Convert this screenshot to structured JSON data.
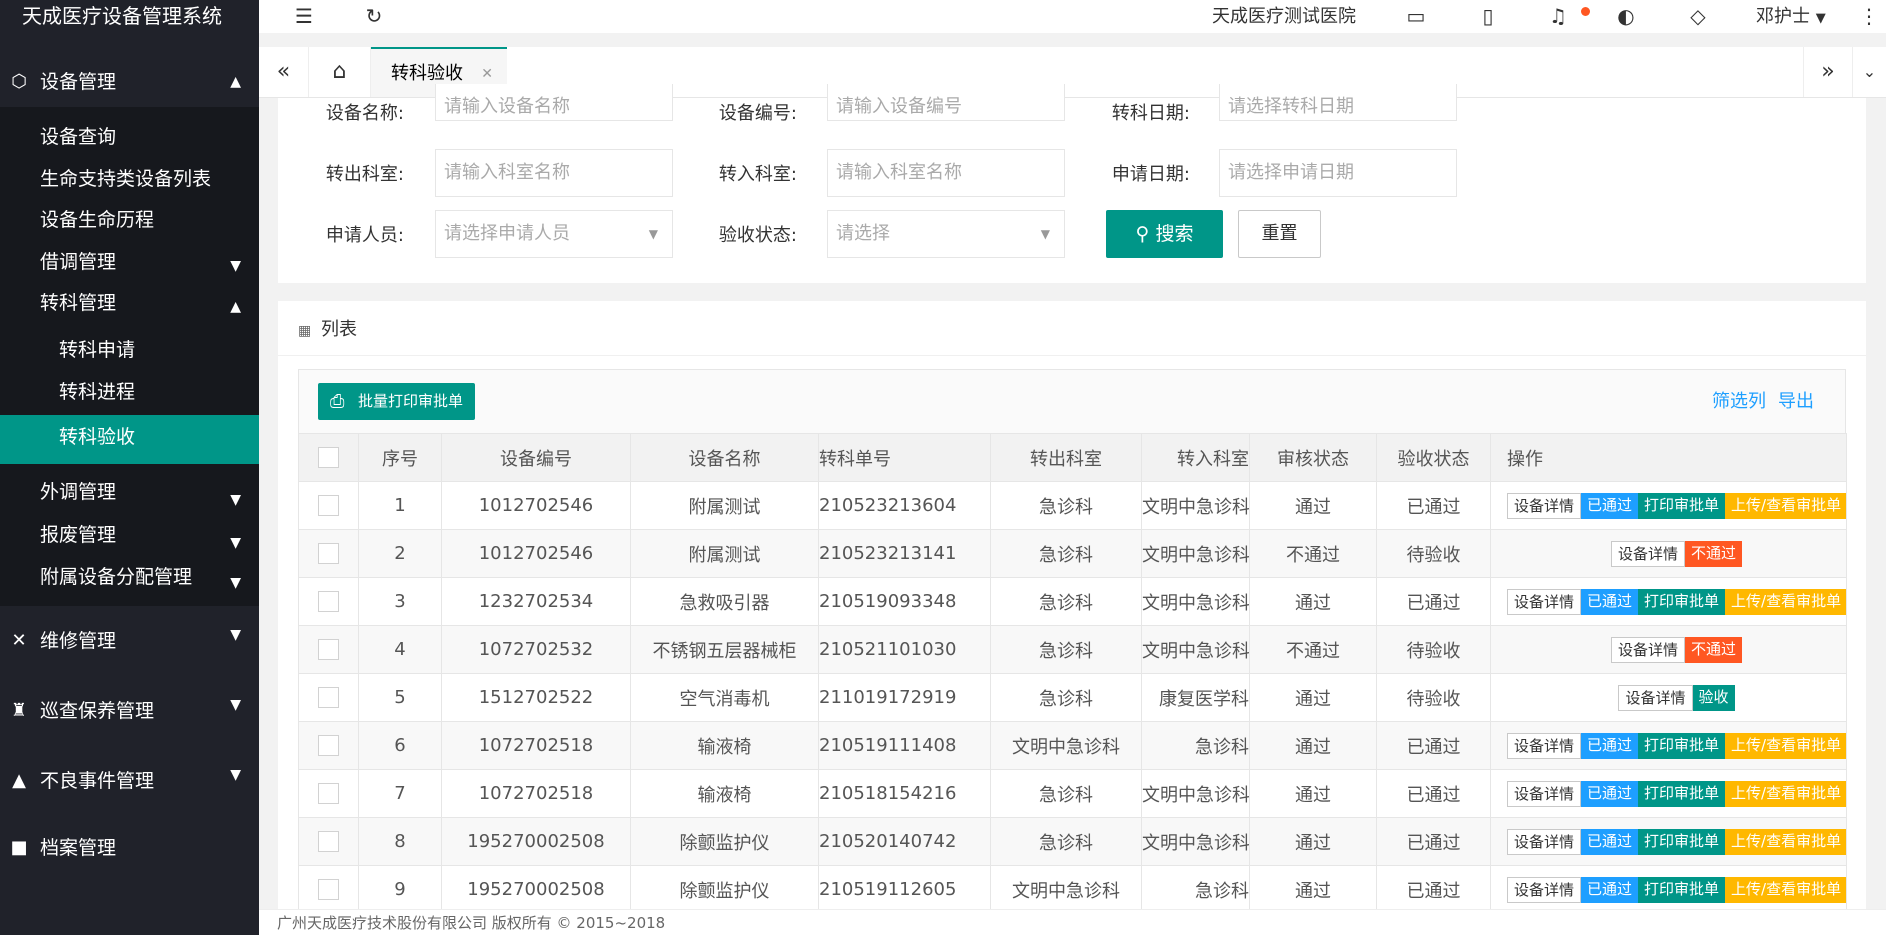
{
  "app": {
    "title": "天成医疗设备管理系统"
  },
  "sidebar": {
    "group_equipment": "设备管理",
    "items": {
      "query": "设备查询",
      "life_support": "生命支持类设备列表",
      "lifecycle": "设备生命历程",
      "loan": "借调管理",
      "transfer": "转科管理",
      "transfer_apply": "转科申请",
      "transfer_progress": "转科进程",
      "transfer_accept": "转科验收",
      "external_loan": "外调管理",
      "scrap": "报废管理",
      "accessory": "附属设备分配管理"
    },
    "group_repair": "维修管理",
    "group_inspection": "巡查保养管理",
    "group_adverse": "不良事件管理",
    "group_more": "档案管理"
  },
  "header": {
    "hospital": "天成医疗测试医院",
    "user": "邓护士"
  },
  "tabs": {
    "active": "转科验收"
  },
  "search": {
    "device_name": {
      "label": "设备名称:",
      "placeholder": "请输入设备名称"
    },
    "device_no": {
      "label": "设备编号:",
      "placeholder": "请输入设备编号"
    },
    "transfer_date": {
      "label": "转科日期:",
      "placeholder": "请选择转科日期"
    },
    "out_dept": {
      "label": "转出科室:",
      "placeholder": "请输入科室名称"
    },
    "in_dept": {
      "label": "转入科室:",
      "placeholder": "请输入科室名称"
    },
    "apply_date": {
      "label": "申请日期:",
      "placeholder": "请选择申请日期"
    },
    "applicant": {
      "label": "申请人员:",
      "placeholder": "请选择申请人员"
    },
    "accept_status": {
      "label": "验收状态:",
      "placeholder": "请选择"
    },
    "search_btn": "搜索",
    "reset_btn": "重置"
  },
  "list": {
    "title": "列表",
    "batch_print": "批量打印审批单",
    "filter_cols": "筛选列",
    "export": "导出",
    "columns": [
      "序号",
      "设备编号",
      "设备名称",
      "转科单号",
      "转出科室",
      "转入科室",
      "审核状态",
      "验收状态",
      "操作"
    ],
    "rows": [
      {
        "idx": "1",
        "device_no": "1012702546",
        "name": "附属测试",
        "order": "210523213604",
        "out": "急诊科",
        "in": "文明中急诊科",
        "audit": "通过",
        "audit_ok": true,
        "accept": "已通过",
        "accept_done": true,
        "ops": [
          "设备详情",
          "已通过",
          "打印审批单",
          "上传/查看审批单"
        ]
      },
      {
        "idx": "2",
        "device_no": "1012702546",
        "name": "附属测试",
        "order": "210523213141",
        "out": "急诊科",
        "in": "文明中急诊科",
        "audit": "不通过",
        "audit_ok": false,
        "accept": "待验收",
        "accept_done": false,
        "ops": [
          "设备详情",
          "不通过"
        ]
      },
      {
        "idx": "3",
        "device_no": "1232702534",
        "name": "急救吸引器",
        "order": "210519093348",
        "out": "急诊科",
        "in": "文明中急诊科",
        "audit": "通过",
        "audit_ok": true,
        "accept": "已通过",
        "accept_done": true,
        "ops": [
          "设备详情",
          "已通过",
          "打印审批单",
          "上传/查看审批单"
        ]
      },
      {
        "idx": "4",
        "device_no": "1072702532",
        "name": "不锈钢五层器械柜",
        "order": "210521101030",
        "out": "急诊科",
        "in": "文明中急诊科",
        "audit": "不通过",
        "audit_ok": false,
        "accept": "待验收",
        "accept_done": false,
        "ops": [
          "设备详情",
          "不通过"
        ]
      },
      {
        "idx": "5",
        "device_no": "1512702522",
        "name": "空气消毒机",
        "order": "211019172919",
        "out": "急诊科",
        "in": "康复医学科",
        "audit": "通过",
        "audit_ok": true,
        "accept": "待验收",
        "accept_done": false,
        "ops": [
          "设备详情",
          "验收"
        ]
      },
      {
        "idx": "6",
        "device_no": "1072702518",
        "name": "输液椅",
        "order": "210519111408",
        "out": "文明中急诊科",
        "in": "急诊科",
        "audit": "通过",
        "audit_ok": true,
        "accept": "已通过",
        "accept_done": true,
        "ops": [
          "设备详情",
          "已通过",
          "打印审批单",
          "上传/查看审批单"
        ]
      },
      {
        "idx": "7",
        "device_no": "1072702518",
        "name": "输液椅",
        "order": "210518154216",
        "out": "急诊科",
        "in": "文明中急诊科",
        "audit": "通过",
        "audit_ok": true,
        "accept": "已通过",
        "accept_done": true,
        "ops": [
          "设备详情",
          "已通过",
          "打印审批单",
          "上传/查看审批单"
        ]
      },
      {
        "idx": "8",
        "device_no": "195270002508",
        "name": "除颤监护仪",
        "order": "210520140742",
        "out": "急诊科",
        "in": "文明中急诊科",
        "audit": "通过",
        "audit_ok": true,
        "accept": "已通过",
        "accept_done": true,
        "ops": [
          "设备详情",
          "已通过",
          "打印审批单",
          "上传/查看审批单"
        ]
      },
      {
        "idx": "9",
        "device_no": "195270002508",
        "name": "除颤监护仪",
        "order": "210519112605",
        "out": "文明中急诊科",
        "in": "急诊科",
        "audit": "通过",
        "audit_ok": true,
        "accept": "已通过",
        "accept_done": true,
        "ops": [
          "设备详情",
          "已通过",
          "打印审批单",
          "上传/查看审批单"
        ]
      }
    ]
  },
  "footer": {
    "copyright": "广州天成医疗技术股份有限公司 版权所有 © 2015~2018"
  }
}
